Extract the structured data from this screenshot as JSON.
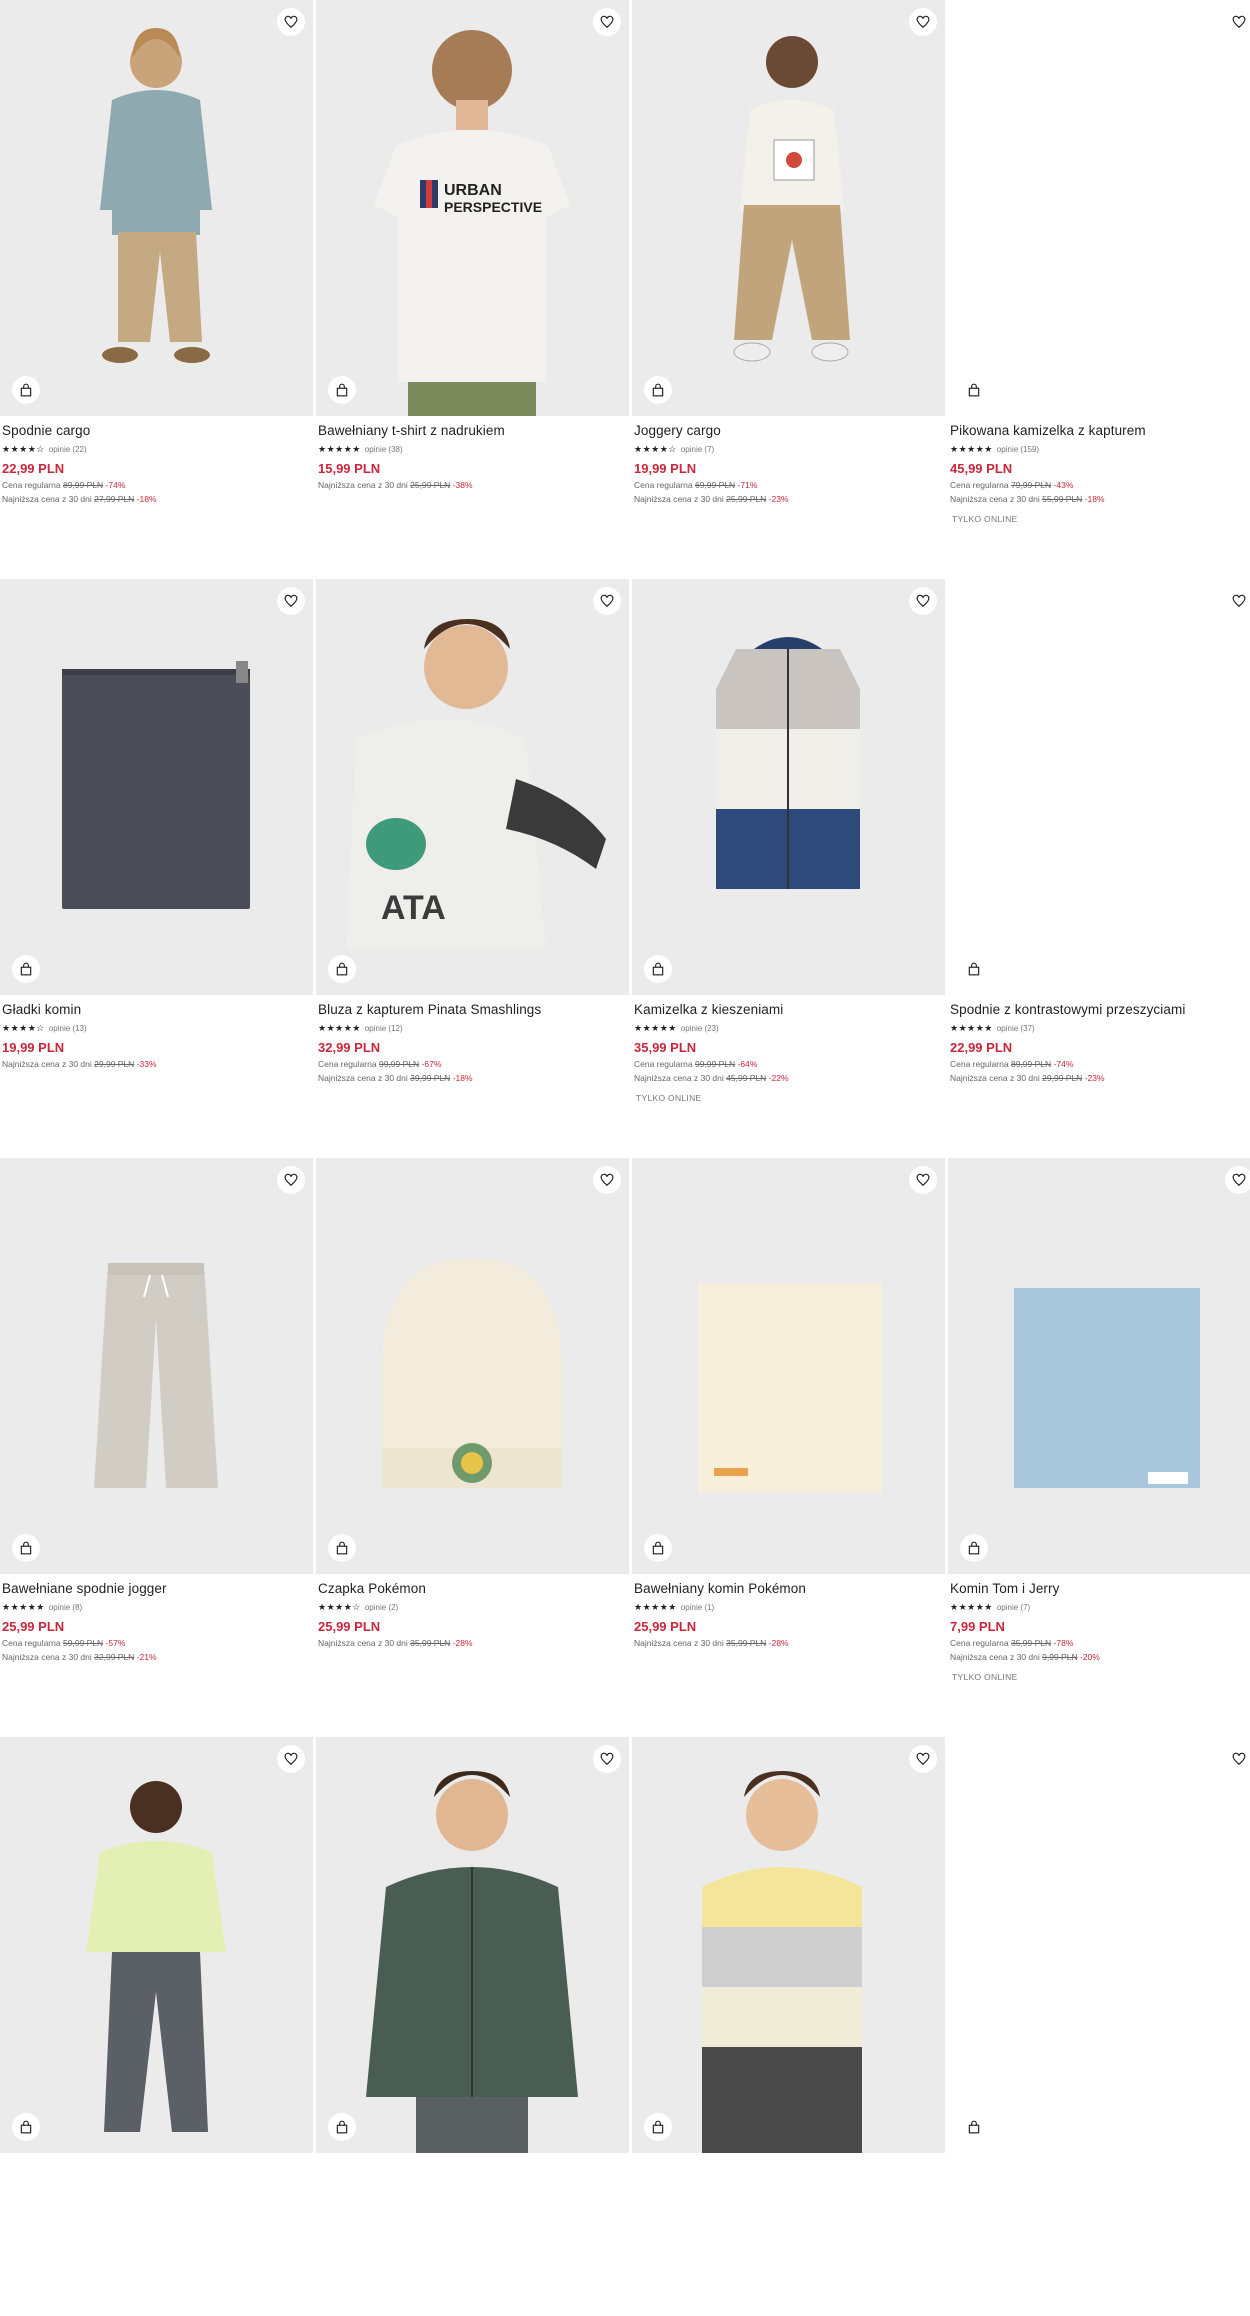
{
  "products": [
    {
      "name": "Spodnie cargo",
      "stars": "★★★★☆",
      "reviews": "opinie (22)",
      "price": "22,99 PLN",
      "regular_label": "Cena regularna",
      "regular_price": "89,99 PLN",
      "regular_pct": "-74%",
      "lowest_label": "Najniższa cena z 30 dni",
      "lowest_price": "27,99 PLN",
      "lowest_pct": "-18%",
      "badge": "",
      "image": "boy-sweater-cargo"
    },
    {
      "name": "Bawełniany t-shirt z nadrukiem",
      "stars": "★★★★★",
      "reviews": "opinie (38)",
      "price": "15,99 PLN",
      "regular_label": "",
      "regular_price": "",
      "regular_pct": "",
      "lowest_label": "Najniższa cena z 30 dni",
      "lowest_price": "25,99 PLN",
      "lowest_pct": "-38%",
      "badge": "",
      "image": "boy-tshirt-back"
    },
    {
      "name": "Joggery cargo",
      "stars": "★★★★☆",
      "reviews": "opinie (7)",
      "price": "19,99 PLN",
      "regular_label": "Cena regularna",
      "regular_price": "69,99 PLN",
      "regular_pct": "-71%",
      "lowest_label": "Najniższa cena z 30 dni",
      "lowest_price": "25,99 PLN",
      "lowest_pct": "-23%",
      "badge": "",
      "image": "boy-joggers"
    },
    {
      "name": "Pikowana kamizelka z kapturem",
      "stars": "★★★★★",
      "reviews": "opinie (159)",
      "price": "45,99 PLN",
      "regular_label": "Cena regularna",
      "regular_price": "79,99 PLN",
      "regular_pct": "-43%",
      "lowest_label": "Najniższa cena z 30 dni",
      "lowest_price": "55,99 PLN",
      "lowest_pct": "-18%",
      "badge": "TYLKO ONLINE",
      "image": "blank"
    },
    {
      "name": "Gładki komin",
      "stars": "★★★★☆",
      "reviews": "opinie (13)",
      "price": "19,99 PLN",
      "regular_label": "",
      "regular_price": "",
      "regular_pct": "",
      "lowest_label": "Najniższa cena z 30 dni",
      "lowest_price": "29,99 PLN",
      "lowest_pct": "-33%",
      "badge": "",
      "image": "grey-snood"
    },
    {
      "name": "Bluza z kapturem Pinata Smashlings",
      "stars": "★★★★★",
      "reviews": "opinie (12)",
      "price": "32,99 PLN",
      "regular_label": "Cena regularna",
      "regular_price": "99,99 PLN",
      "regular_pct": "-67%",
      "lowest_label": "Najniższa cena z 30 dni",
      "lowest_price": "39,99 PLN",
      "lowest_pct": "-18%",
      "badge": "",
      "image": "boy-hoodie"
    },
    {
      "name": "Kamizelka z kieszeniami",
      "stars": "★★★★★",
      "reviews": "opinie (23)",
      "price": "35,99 PLN",
      "regular_label": "Cena regularna",
      "regular_price": "99,99 PLN",
      "regular_pct": "-64%",
      "lowest_label": "Najniższa cena z 30 dni",
      "lowest_price": "45,99 PLN",
      "lowest_pct": "-22%",
      "badge": "TYLKO ONLINE",
      "image": "vest"
    },
    {
      "name": "Spodnie z kontrastowymi przeszyciami",
      "stars": "★★★★★",
      "reviews": "opinie (37)",
      "price": "22,99 PLN",
      "regular_label": "Cena regularna",
      "regular_price": "89,99 PLN",
      "regular_pct": "-74%",
      "lowest_label": "Najniższa cena z 30 dni",
      "lowest_price": "29,99 PLN",
      "lowest_pct": "-23%",
      "badge": "",
      "image": "blank"
    },
    {
      "name": "Bawełniane spodnie jogger",
      "stars": "★★★★★",
      "reviews": "opinie (8)",
      "price": "25,99 PLN",
      "regular_label": "Cena regularna",
      "regular_price": "59,99 PLN",
      "regular_pct": "-57%",
      "lowest_label": "Najniższa cena z 30 dni",
      "lowest_price": "32,99 PLN",
      "lowest_pct": "-21%",
      "badge": "",
      "image": "beige-pants"
    },
    {
      "name": "Czapka Pokémon",
      "stars": "★★★★☆",
      "reviews": "opinie (2)",
      "price": "25,99 PLN",
      "regular_label": "",
      "regular_price": "",
      "regular_pct": "",
      "lowest_label": "Najniższa cena z 30 dni",
      "lowest_price": "35,99 PLN",
      "lowest_pct": "-28%",
      "badge": "",
      "image": "beanie"
    },
    {
      "name": "Bawełniany komin Pokémon",
      "stars": "★★★★★",
      "reviews": "opinie (1)",
      "price": "25,99 PLN",
      "regular_label": "",
      "regular_price": "",
      "regular_pct": "",
      "lowest_label": "Najniższa cena z 30 dni",
      "lowest_price": "35,99 PLN",
      "lowest_pct": "-28%",
      "badge": "",
      "image": "cream-snood"
    },
    {
      "name": "Komin Tom i Jerry",
      "stars": "★★★★★",
      "reviews": "opinie (7)",
      "price": "7,99 PLN",
      "regular_label": "Cena regularna",
      "regular_price": "35,99 PLN",
      "regular_pct": "-78%",
      "lowest_label": "Najniższa cena z 30 dni",
      "lowest_price": "9,99 PLN",
      "lowest_pct": "-20%",
      "badge": "TYLKO ONLINE",
      "image": "blue-snood"
    },
    {
      "name": "",
      "image": "boy-lime-sweatshirt"
    },
    {
      "name": "",
      "image": "boy-green-jacket"
    },
    {
      "name": "",
      "image": "boy-colorblock-jacket"
    },
    {
      "name": "",
      "image": "blank"
    }
  ],
  "icons": {
    "favorite": "heart-icon",
    "cart": "shopping-bag-icon"
  },
  "colors": {
    "sale": "#c8283c",
    "image_bg": "#ebebeb"
  }
}
